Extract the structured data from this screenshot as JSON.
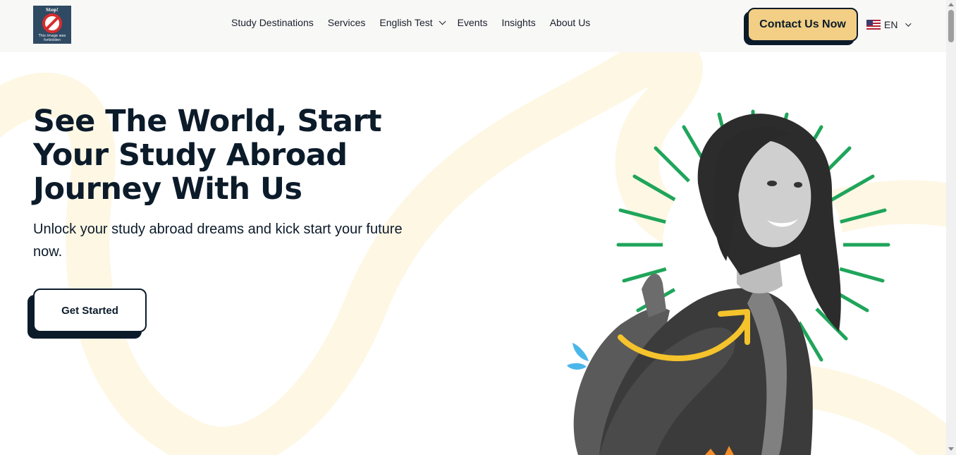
{
  "header": {
    "logo": {
      "stop_text": "Stop!",
      "caption": "This image was forbidden"
    },
    "nav": [
      {
        "label": "Study Destinations"
      },
      {
        "label": "Services"
      },
      {
        "label": "English Test",
        "has_dropdown": true
      },
      {
        "label": "Events"
      },
      {
        "label": "Insights"
      },
      {
        "label": "About Us"
      }
    ],
    "contact_button": "Contact Us Now",
    "language": {
      "code": "EN",
      "flag": "us-flag-icon"
    }
  },
  "hero": {
    "title": "See The World, Start Your Study Abroad Journey With Us",
    "subtitle": "Unlock your study abroad dreams and kick start your future now.",
    "cta": "Get Started"
  },
  "colors": {
    "accent": "#f2cf85",
    "dark": "#0c1b2a",
    "burst_green": "#1fa55a",
    "arrow_yellow": "#f5c32c",
    "leaf_blue": "#4bb6ea",
    "squiggle": "#fdf7e4"
  }
}
